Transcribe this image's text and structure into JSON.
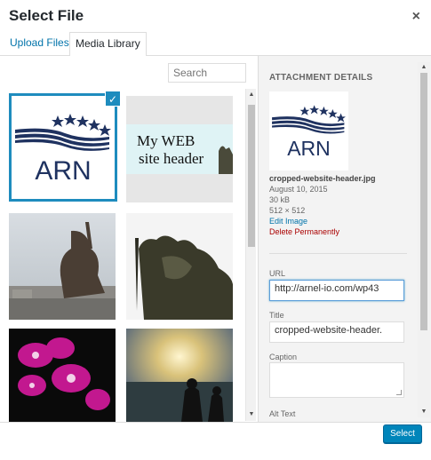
{
  "modal": {
    "title": "Select File",
    "close_glyph": "×",
    "close_icon": "close-icon"
  },
  "tabs": [
    {
      "label": "Upload Files",
      "active": false
    },
    {
      "label": "Media Library",
      "active": true
    }
  ],
  "search": {
    "placeholder": "Search",
    "value": ""
  },
  "thumbnails": [
    {
      "desc": "ARN logo",
      "selected": true,
      "logo_text": "ARN"
    },
    {
      "desc": "website header",
      "line1": "My WEB",
      "line2": "site header"
    },
    {
      "desc": "statue photo"
    },
    {
      "desc": "statue photo"
    },
    {
      "desc": "orchid photo"
    },
    {
      "desc": "sunset beach photo"
    }
  ],
  "check_glyph": "✓",
  "details": {
    "heading": "ATTACHMENT DETAILS",
    "preview_logo_text": "ARN",
    "filename": "cropped-website-header.jpg",
    "date": "August 10, 2015",
    "size": "30 kB",
    "dimensions": "512 × 512",
    "edit_link": "Edit Image",
    "delete_link": "Delete Permanently",
    "url_label": "URL",
    "url_value": "http://arnel-io.com/wp43",
    "title_label": "Title",
    "title_value": "cropped-website-header.",
    "caption_label": "Caption",
    "caption_value": "",
    "alt_label": "Alt Text"
  },
  "toolbar": {
    "select_label": "Select"
  },
  "colors": {
    "accent": "#0085ba",
    "link": "#0073aa",
    "delete": "#a00000",
    "selected_border": "#1e8cbe",
    "logo_navy": "#1f3260"
  }
}
